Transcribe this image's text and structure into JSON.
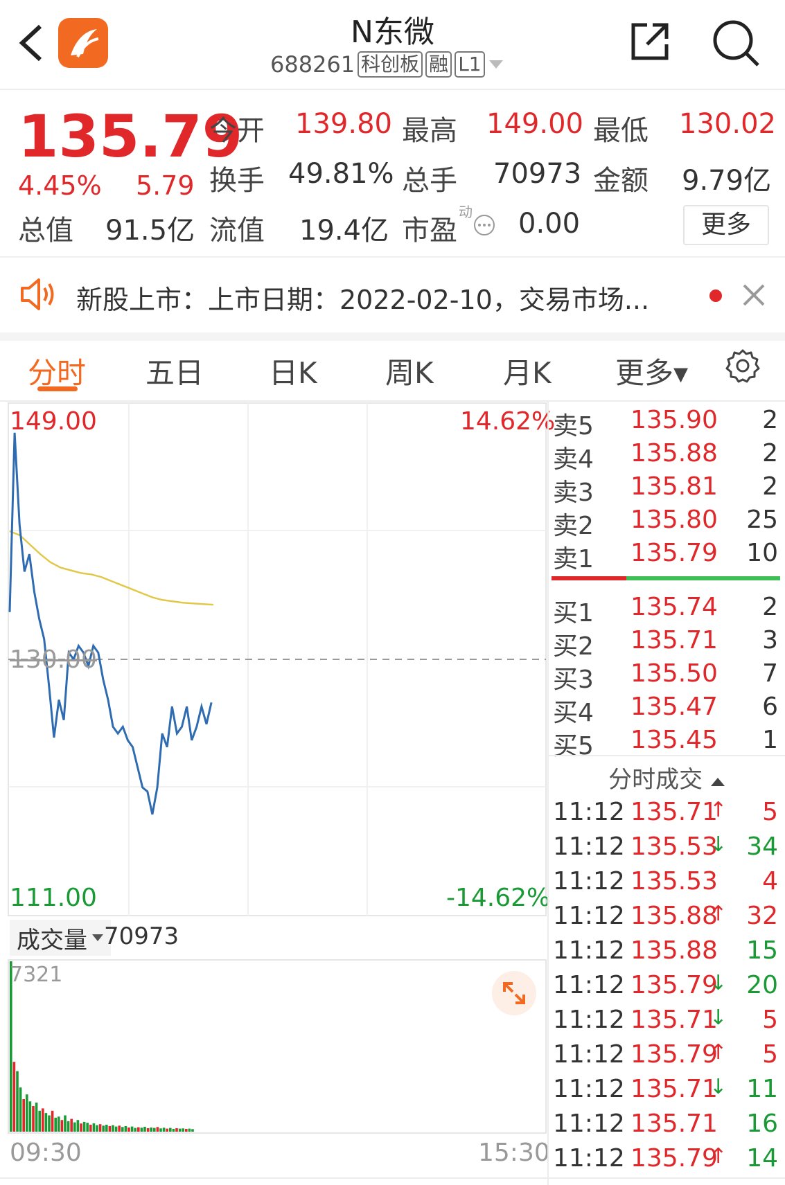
{
  "header": {
    "title": "N东微",
    "code": "688261",
    "tags": [
      "科创板",
      "融",
      "L1"
    ]
  },
  "quote": {
    "price": "135.79",
    "change_pct": "4.45%",
    "change": "5.79",
    "fields": [
      {
        "label": "今开",
        "value": "139.80"
      },
      {
        "label": "最高",
        "value": "149.00"
      },
      {
        "label": "最低",
        "value": "130.02"
      },
      {
        "label": "换手",
        "value": "49.81%"
      },
      {
        "label": "总手",
        "value": "70973"
      },
      {
        "label": "金额",
        "value": "9.79亿"
      },
      {
        "label": "总值",
        "value": "91.5亿"
      },
      {
        "label": "流值",
        "value": "19.4亿"
      },
      {
        "label": "市盈",
        "value": "0.00"
      }
    ],
    "pe_sup": "动",
    "more_button": "更多"
  },
  "notice": {
    "text": "新股上市：上市日期：2022-02-10，交易市场..."
  },
  "tabs": [
    "分时",
    "五日",
    "日K",
    "周K",
    "月K",
    "更多▾"
  ],
  "chart": {
    "y_max_label": "149.00",
    "y_mid_label": "130.00",
    "y_min_label": "111.00",
    "pct_max_label": "14.62%",
    "pct_min_label": "-14.62%",
    "volume_selector": "成交量",
    "volume_total": "70973",
    "volume_max_label": "7321",
    "time_start": "09:30",
    "time_end": "15:30"
  },
  "chart_data": {
    "type": "line",
    "ylim": [
      111.0,
      149.0
    ],
    "prev_close": 130.0,
    "series": [
      {
        "values": [
          133.5,
          146.8,
          140,
          136.5,
          137.8,
          135,
          133,
          131.5,
          128,
          124.2,
          127,
          125.5,
          130.5,
          130,
          131,
          130.5,
          129.5,
          131,
          130.5,
          128.5,
          127,
          125,
          124.5,
          125,
          124,
          123.5,
          122,
          120.5,
          120.2,
          118.5,
          120.5,
          124.5,
          123.5,
          126.5,
          124.5,
          125,
          126.5,
          124,
          125,
          126.5,
          125.2,
          126.8
        ]
      },
      {
        "values": [
          139.5,
          139.2,
          138.5,
          137.8,
          137.2,
          136.8,
          136.6,
          136.4,
          136.3,
          136.1,
          135.8,
          135.5,
          135.2,
          134.9,
          134.6,
          134.4,
          134.3,
          134.2,
          134.15,
          134.1,
          134.05
        ]
      }
    ],
    "volume": [
      7321,
      3000,
      2600,
      1900,
      1400,
      1600,
      1300,
      1100,
      1250,
      900,
      1000,
      800,
      700,
      900,
      600,
      650,
      500,
      700,
      450,
      550,
      400,
      500,
      350,
      420,
      380,
      300,
      360,
      280,
      320,
      260,
      300,
      240,
      280,
      220,
      260,
      200,
      240,
      180,
      220,
      160,
      190,
      170,
      210,
      150,
      180,
      160,
      200,
      140,
      170,
      130,
      160,
      120,
      150,
      130,
      140,
      120,
      130,
      110
    ]
  },
  "orderbook": {
    "asks": [
      {
        "label": "卖5",
        "price": "135.90",
        "vol": "2"
      },
      {
        "label": "卖4",
        "price": "135.88",
        "vol": "2"
      },
      {
        "label": "卖3",
        "price": "135.81",
        "vol": "2"
      },
      {
        "label": "卖2",
        "price": "135.80",
        "vol": "25"
      },
      {
        "label": "卖1",
        "price": "135.79",
        "vol": "10"
      }
    ],
    "bids": [
      {
        "label": "买1",
        "price": "135.74",
        "vol": "2"
      },
      {
        "label": "买2",
        "price": "135.71",
        "vol": "3"
      },
      {
        "label": "买3",
        "price": "135.50",
        "vol": "7"
      },
      {
        "label": "买4",
        "price": "135.47",
        "vol": "6"
      },
      {
        "label": "买5",
        "price": "135.45",
        "vol": "1"
      }
    ]
  },
  "ticks": {
    "title": "分时成交",
    "rows": [
      {
        "time": "11:12",
        "price": "135.71",
        "arrow": "↑",
        "vol": "5",
        "dir": "up"
      },
      {
        "time": "11:12",
        "price": "135.53",
        "arrow": "↓",
        "vol": "34",
        "dir": "down"
      },
      {
        "time": "11:12",
        "price": "135.53",
        "arrow": "",
        "vol": "4",
        "dir": "up"
      },
      {
        "time": "11:12",
        "price": "135.88",
        "arrow": "↑",
        "vol": "32",
        "dir": "up"
      },
      {
        "time": "11:12",
        "price": "135.88",
        "arrow": "",
        "vol": "15",
        "dir": "down"
      },
      {
        "time": "11:12",
        "price": "135.79",
        "arrow": "↓",
        "vol": "20",
        "dir": "down"
      },
      {
        "time": "11:12",
        "price": "135.71",
        "arrow": "↓",
        "vol": "5",
        "dir": "up"
      },
      {
        "time": "11:12",
        "price": "135.79",
        "arrow": "↑",
        "vol": "5",
        "dir": "up"
      },
      {
        "time": "11:12",
        "price": "135.71",
        "arrow": "↓",
        "vol": "11",
        "dir": "down"
      },
      {
        "time": "11:12",
        "price": "135.71",
        "arrow": "",
        "vol": "16",
        "dir": "down"
      },
      {
        "time": "11:12",
        "price": "135.79",
        "arrow": "↑",
        "vol": "14",
        "dir": "down"
      }
    ]
  },
  "colors": {
    "up": "#e0282b",
    "down": "#1a9a35",
    "price_line": "#2f6bb0",
    "avg_line": "#e2c84a",
    "brand": "#f26a21"
  }
}
